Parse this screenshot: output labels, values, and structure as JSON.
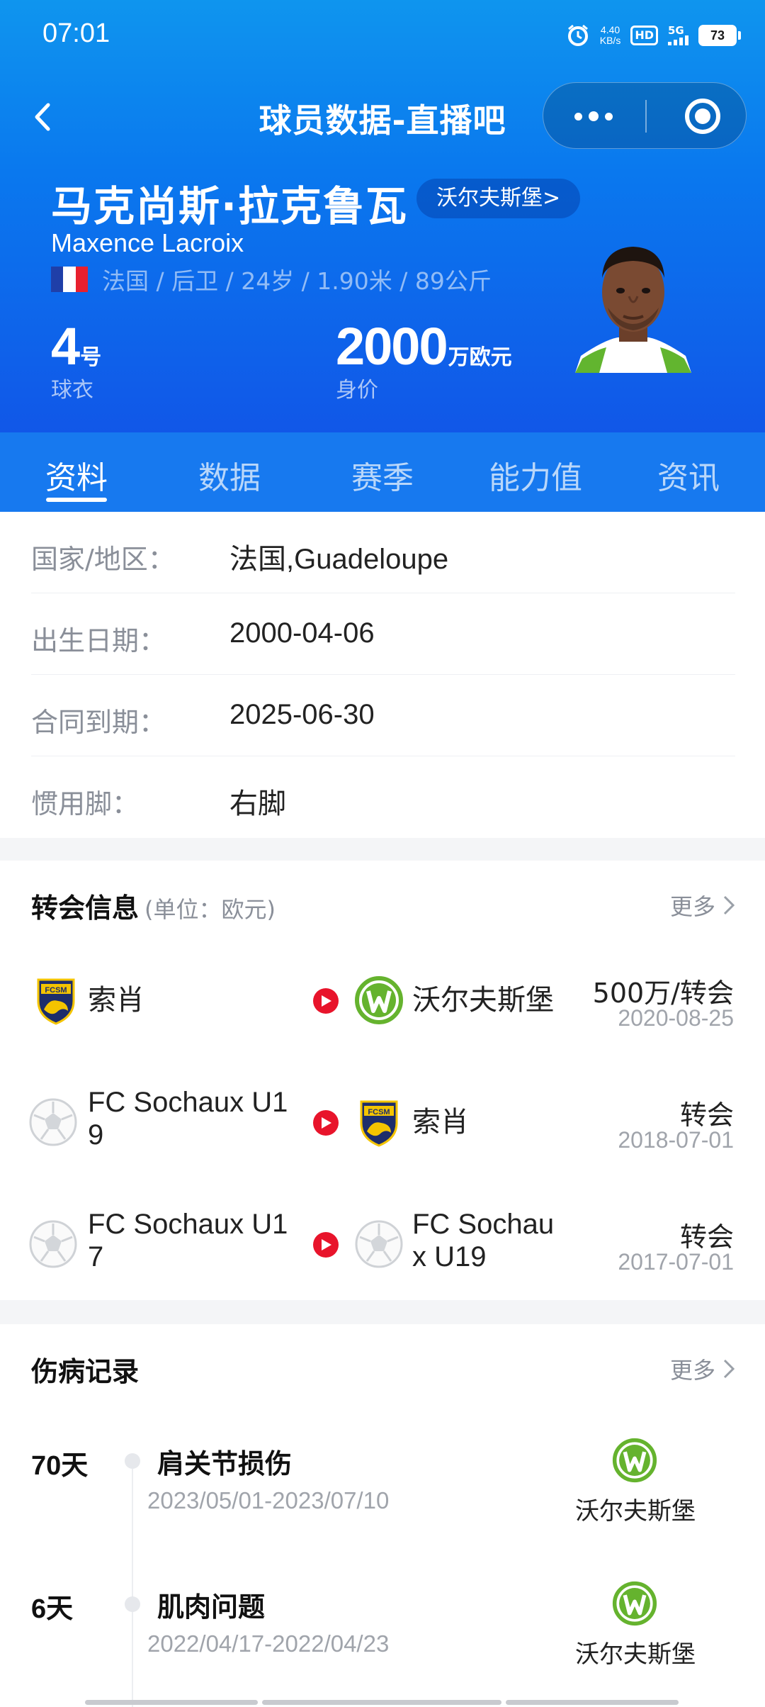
{
  "status_bar": {
    "time": "07:01",
    "net_speed": "4.40",
    "net_unit": "KB/s",
    "hd": "HD",
    "network": "5G",
    "battery": "73"
  },
  "nav": {
    "title": "球员数据-直播吧",
    "back_icon": "chevron-left-icon",
    "more_icon": "more-dots-icon",
    "close_icon": "target-close-icon"
  },
  "player": {
    "name_cn": "马克尚斯·拉克鲁瓦",
    "club_chip": "沃尔夫斯堡>",
    "name_en": "Maxence Lacroix",
    "meta": "法国 / 后卫 / 24岁 / 1.90米 / 89公斤",
    "shirt_number": "4",
    "shirt_unit": "号",
    "shirt_label": "球衣",
    "value": "2000",
    "value_unit": "万欧元",
    "value_label": "身价"
  },
  "tabs": [
    {
      "label": "资料",
      "active": true
    },
    {
      "label": "数据",
      "active": false
    },
    {
      "label": "赛季",
      "active": false
    },
    {
      "label": "能力值",
      "active": false
    },
    {
      "label": "资讯",
      "active": false
    }
  ],
  "info": [
    {
      "key": "国家/地区：",
      "value": "法国,Guadeloupe"
    },
    {
      "key": "出生日期：",
      "value": "2000-04-06"
    },
    {
      "key": "合同到期：",
      "value": "2025-06-30"
    },
    {
      "key": "惯用脚：",
      "value": "右脚"
    }
  ],
  "transfers": {
    "title": "转会信息",
    "subtitle": "(单位：欧元)",
    "more": "更多",
    "rows": [
      {
        "from_line1": "索肖",
        "from_line2": "",
        "from_icon": "sochaux-badge-icon",
        "to_line1": "沃尔夫斯堡",
        "to_line2": "",
        "to_icon": "wolfsburg-badge-icon",
        "fee": "500万/转会",
        "date": "2020-08-25"
      },
      {
        "from_line1": "FC Sochaux U1",
        "from_line2": "9",
        "from_icon": "football-icon",
        "to_line1": "索肖",
        "to_line2": "",
        "to_icon": "sochaux-badge-icon",
        "fee": "转会",
        "date": "2018-07-01"
      },
      {
        "from_line1": "FC Sochaux U1",
        "from_line2": "7",
        "from_icon": "football-icon",
        "to_line1": "FC Sochau",
        "to_line2": "x U19",
        "to_icon": "football-icon",
        "fee": "转会",
        "date": "2017-07-01"
      }
    ]
  },
  "injuries": {
    "title": "伤病记录",
    "more": "更多",
    "rows": [
      {
        "days": "70",
        "days_unit": "天",
        "type": "肩关节损伤",
        "range": "2023/05/01-2023/07/10",
        "club": "沃尔夫斯堡",
        "club_icon": "wolfsburg-badge-icon"
      },
      {
        "days": "6",
        "days_unit": "天",
        "type": "肌肉问题",
        "range": "2022/04/17-2022/04/23",
        "club": "沃尔夫斯堡",
        "club_icon": "wolfsburg-badge-icon"
      }
    ]
  },
  "colors": {
    "header_blue": "#0a78ee",
    "tab_bar_blue": "#1779ef",
    "arrow_red": "#e8142b",
    "wolfsburg_green": "#65b32e",
    "sochaux_yellow": "#f4c400",
    "sochaux_navy": "#1d2d6b"
  }
}
